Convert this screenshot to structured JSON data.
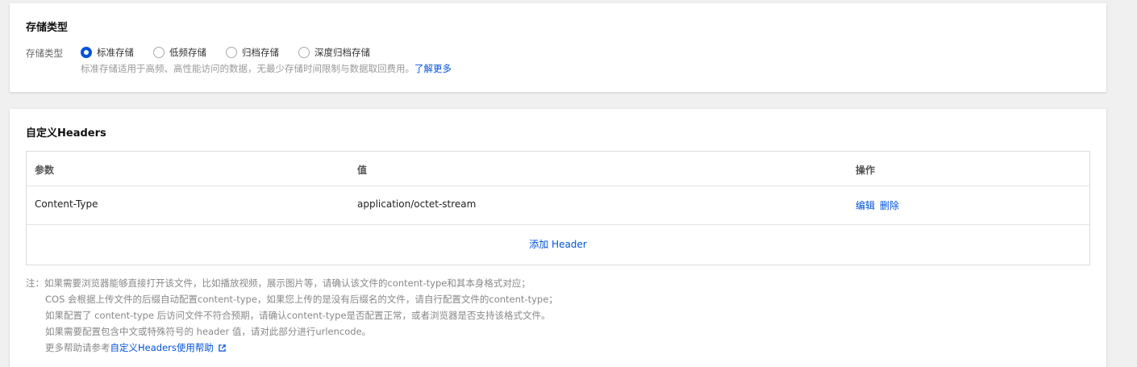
{
  "storage": {
    "title": "存储类型",
    "label": "存储类型",
    "options": [
      "标准存储",
      "低频存储",
      "归档存储",
      "深度归档存储"
    ],
    "selected": "标准存储",
    "hint": "标准存储适用于高频、高性能访问的数据，无最少存储时间限制与数据取回费用。",
    "learn_more": "了解更多"
  },
  "headers": {
    "title": "自定义Headers",
    "columns": [
      "参数",
      "值",
      "操作"
    ],
    "rows": [
      {
        "param": "Content-Type",
        "value": "application/octet-stream",
        "edit": "编辑",
        "delete": "删除"
      }
    ],
    "add_label": "添加 Header"
  },
  "notes": {
    "line1": "注：如果需要浏览器能够直接打开该文件，比如播放视频，展示图片等，请确认该文件的content-type和其本身格式对应；",
    "line2": "COS 会根据上传文件的后缀自动配置content-type，如果您上传的是没有后缀名的文件，请自行配置文件的content-type；",
    "line3": "如果配置了 content-type 后访问文件不符合预期，请确认content-type是否配置正常，或者浏览器是否支持该格式文件。",
    "line4": "如果需要配置包含中文或特殊符号的 header 值，请对此部分进行urlencode。",
    "line5_prefix": "更多帮助请参考",
    "line5_link": "自定义Headers使用帮助"
  },
  "colors": {
    "accent": "#0052d9"
  }
}
